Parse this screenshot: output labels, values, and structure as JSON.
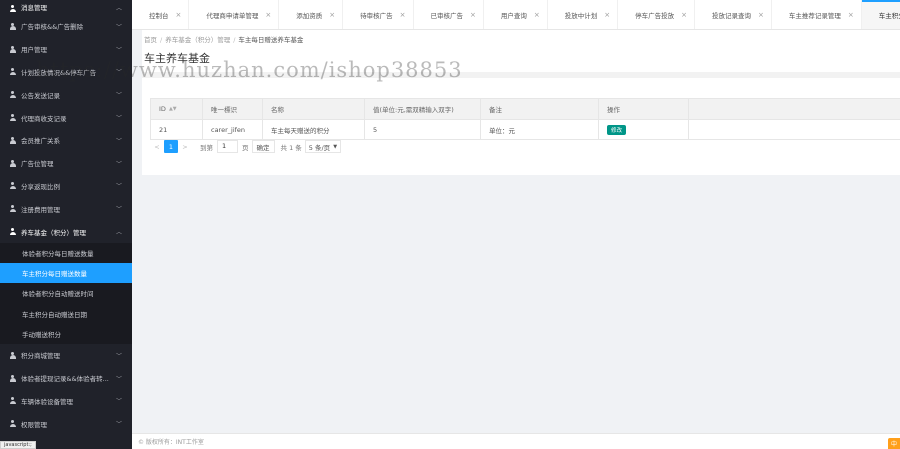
{
  "sidebar": {
    "items_top": [
      {
        "label": "消息管理",
        "open": true,
        "cut": false
      },
      {
        "label": "广告审核&&广告删除",
        "open": false
      },
      {
        "label": "用户管理",
        "open": false
      },
      {
        "label": "计划投放情况&&停车广告",
        "open": false
      },
      {
        "label": "公告发送记录",
        "open": false
      },
      {
        "label": "代理商收支记录",
        "open": false
      },
      {
        "label": "会员推广关系",
        "open": false
      },
      {
        "label": "广告位管理",
        "open": false
      },
      {
        "label": "分享返现比例",
        "open": false
      },
      {
        "label": "注册费用管理",
        "open": false
      },
      {
        "label": "养车基金（积分）管理",
        "open": true
      }
    ],
    "subitems": [
      {
        "label": "体验者积分每日赠送数量",
        "active": false
      },
      {
        "label": "车主积分每日赠送数量",
        "active": true
      },
      {
        "label": "体验者积分自动赠送时间",
        "active": false
      },
      {
        "label": "车主积分自动赠送日期",
        "active": false
      },
      {
        "label": "手动赠送积分",
        "active": false
      }
    ],
    "items_bottom": [
      {
        "label": "积分商城管理"
      },
      {
        "label": "体验者提现记录&&体验者转...",
        "truncated": true
      },
      {
        "label": "车辆体验设备管理"
      },
      {
        "label": "权限管理"
      }
    ]
  },
  "tabs": [
    {
      "label": "控制台",
      "active": false
    },
    {
      "label": "代理商申请单管理",
      "active": false
    },
    {
      "label": "添加资质",
      "active": false
    },
    {
      "label": "待审核广告",
      "active": false
    },
    {
      "label": "已审核广告",
      "active": false
    },
    {
      "label": "用户查询",
      "active": false
    },
    {
      "label": "投放中计划",
      "active": false
    },
    {
      "label": "停车广告投放",
      "active": false
    },
    {
      "label": "投放记录查询",
      "active": false
    },
    {
      "label": "车主推荐记录管理",
      "active": false
    },
    {
      "label": "车主积分每日赠送数量",
      "active": true
    }
  ],
  "breadcrumb": [
    "首页",
    "养车基金（积分）管理",
    "车主每日赠送养车基金"
  ],
  "page_title": "车主养车基金",
  "table": {
    "headers": {
      "id": "ID",
      "key": "唯一標识",
      "name": "名称",
      "value": "值(单位:元,需双精输入双字)",
      "remark": "备注",
      "action": "操作"
    },
    "rows": [
      {
        "id": "21",
        "key": "carer_jifen",
        "name": "车主每天赠送的积分",
        "value": "5",
        "remark": "单位：元",
        "action": "修改"
      }
    ]
  },
  "pager": {
    "prev": "<",
    "current": "1",
    "next": ">",
    "goto_label": "到第",
    "goto_value": "1",
    "page_unit": "页",
    "confirm": "确定",
    "total": "共 1 条",
    "page_size": "5 条/页"
  },
  "footer": "© 版权所有：INT工作室",
  "watermark": "https://www.huzhan.com/ishop38853",
  "corner_badge": "中",
  "status_url": "javascript:;",
  "colors": {
    "sidebar_bg": "#20222a",
    "accent": "#1e9fff",
    "edit_button": "#009688"
  }
}
